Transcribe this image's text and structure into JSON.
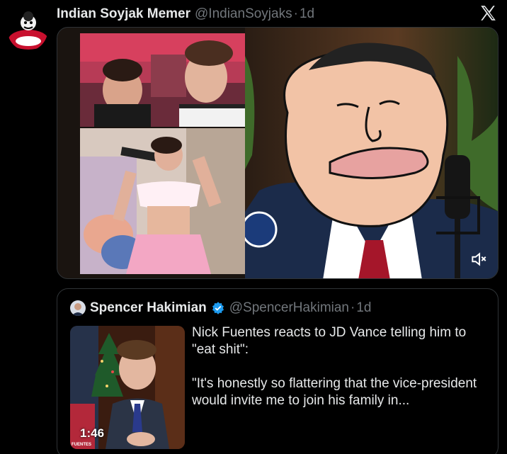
{
  "tweet": {
    "author_name": "Indian Soyjak Memer",
    "author_handle": "@IndianSoyjaks",
    "separator": "·",
    "time": "1d",
    "platform_icon": "x-logo-icon",
    "media_icon": "volume-muted-icon"
  },
  "quoted": {
    "author_name": "Spencer Hakimian",
    "author_handle": "@SpencerHakimian",
    "separator": "·",
    "time": "1d",
    "verified_icon": "verified-badge-icon",
    "verified_color": "#1d9bf0",
    "text_line1": "Nick Fuentes reacts to JD Vance telling him to \"eat shit\":",
    "text_line2": "\"It's honestly so flattering that the vice-president would invite me to join his family in...",
    "video_duration": "1:46",
    "video_brand": "FUENTES"
  },
  "colors": {
    "background": "#000000",
    "border": "#2f3336",
    "muted_text": "#71767b",
    "primary_text": "#e7e9ea",
    "accent": "#1d9bf0"
  }
}
